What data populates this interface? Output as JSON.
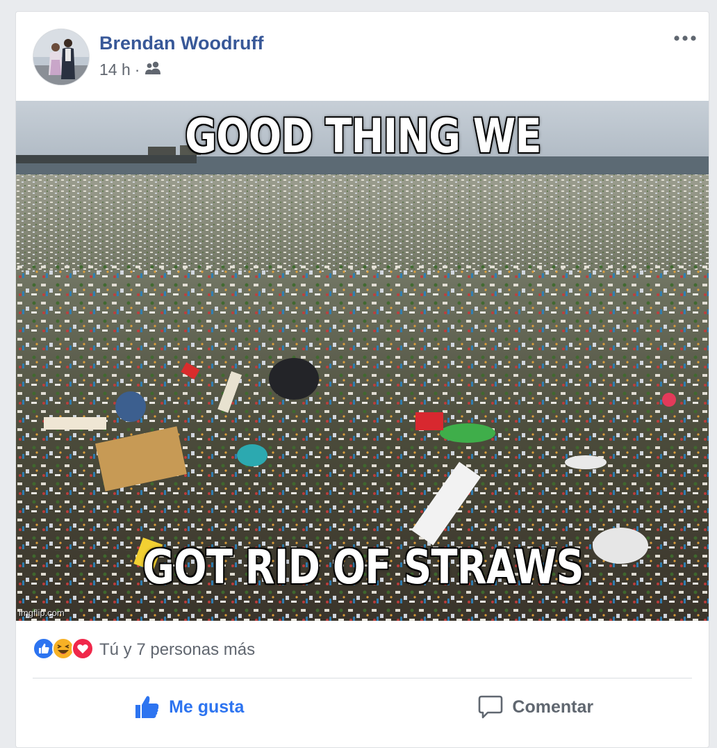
{
  "post": {
    "author": "Brendan Woodruff",
    "time": "14 h",
    "separator": "·",
    "audience_icon": "friends-icon",
    "more_icon": "more-horizontal-icon"
  },
  "meme": {
    "top_text": "GOOD THING WE",
    "bottom_text": "GOT RID OF STRAWS",
    "watermark": "imgflip.com"
  },
  "reactions": {
    "icons": [
      "like-reaction-icon",
      "haha-reaction-icon",
      "love-reaction-icon"
    ],
    "summary": "Tú y 7 personas más",
    "colors": {
      "like": "#2d74f0",
      "haha": "#f7b125",
      "love": "#f0284a"
    }
  },
  "actions": {
    "like_label": "Me gusta",
    "comment_label": "Comentar"
  },
  "colors": {
    "author_link": "#385898",
    "meta_text": "#616770",
    "like_active": "#2d74f0"
  }
}
